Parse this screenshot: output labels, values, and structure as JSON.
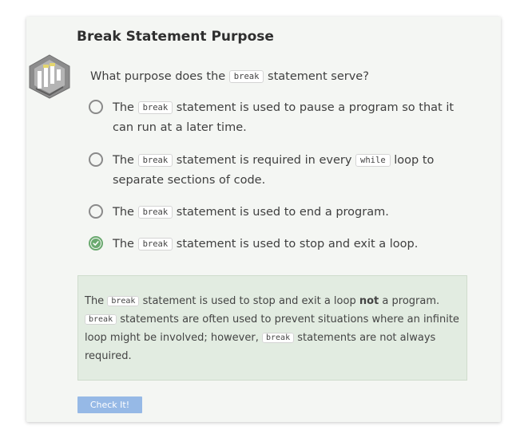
{
  "title": "Break Statement Purpose",
  "question": {
    "prefix": "What purpose does the",
    "code": "break",
    "suffix": "statement serve?"
  },
  "options": [
    {
      "line1": {
        "pre": "The",
        "code": "break",
        "post": "statement is used to pause a program so that it"
      },
      "line2": "can run at a later time.",
      "selected": false
    },
    {
      "line1": {
        "pre": "The",
        "code": "break",
        "mid": "statement is required in every",
        "code2": "while",
        "post": "loop to"
      },
      "line2": "separate sections of code.",
      "selected": false
    },
    {
      "line1": {
        "pre": "The",
        "code": "break",
        "post": "statement is used to end a program."
      },
      "selected": false
    },
    {
      "line1": {
        "pre": "The",
        "code": "break",
        "post": "statement is used to stop and exit a loop."
      },
      "selected": true
    }
  ],
  "feedback": {
    "line1": {
      "pre": "The",
      "code": "break",
      "mid": "statement is used to stop and exit a loop",
      "bold": "not",
      "post": "a program."
    },
    "line2": {
      "code": "break",
      "post": "statements are often used to prevent situations where an infinite"
    },
    "line3": {
      "pre": "loop might be involved; however,",
      "code": "break",
      "post": "statements are not always"
    },
    "line4": "required."
  },
  "check_button": "Check It!",
  "colors": {
    "card_bg": "#f4f6f3",
    "feedback_bg": "#e2ece1",
    "selected_radio": "#6aa96f",
    "button_bg": "#96b9e6"
  }
}
